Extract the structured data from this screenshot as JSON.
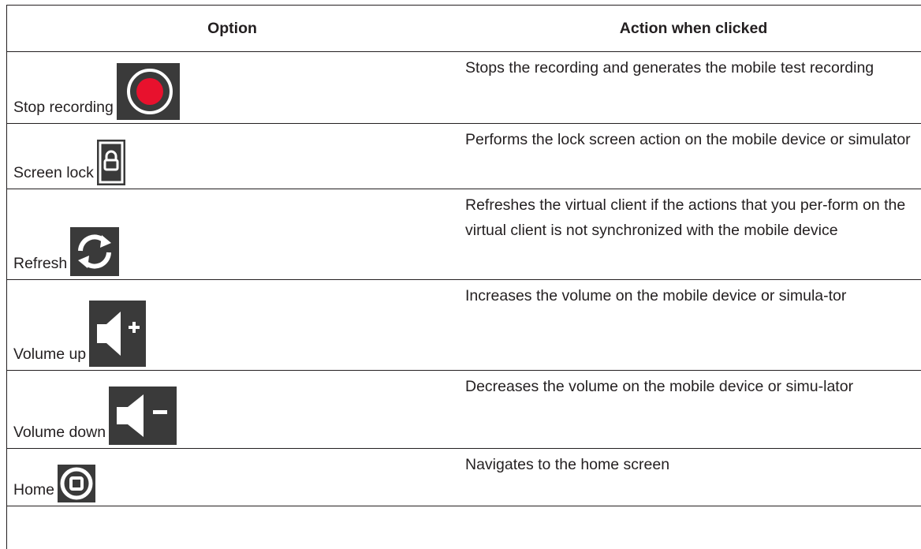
{
  "table": {
    "header_option": "Option",
    "header_action": "Action when clicked",
    "rows": [
      {
        "label": "Stop recording",
        "icon": "record-icon",
        "action": "Stops the recording and generates the mobile test recording"
      },
      {
        "label": "Screen lock",
        "icon": "lock-icon",
        "action": "Performs the lock screen action on the mobile device or simulator"
      },
      {
        "label": "Refresh",
        "icon": "refresh-icon",
        "action": "Refreshes the virtual client if the actions that you per-form on the virtual client is not synchronized with the mobile device"
      },
      {
        "label": "Volume up",
        "icon": "volume-up-icon",
        "action": "Increases the volume on the mobile device or simula-tor"
      },
      {
        "label": "Volume down",
        "icon": "volume-down-icon",
        "action": "Decreases the volume on the mobile device or simu-lator"
      },
      {
        "label": "Home",
        "icon": "home-icon",
        "action": "Navigates to the home screen"
      }
    ]
  },
  "colors": {
    "icon_bg": "#3a3a3a",
    "record_red": "#e8112d",
    "text": "#231f20"
  }
}
